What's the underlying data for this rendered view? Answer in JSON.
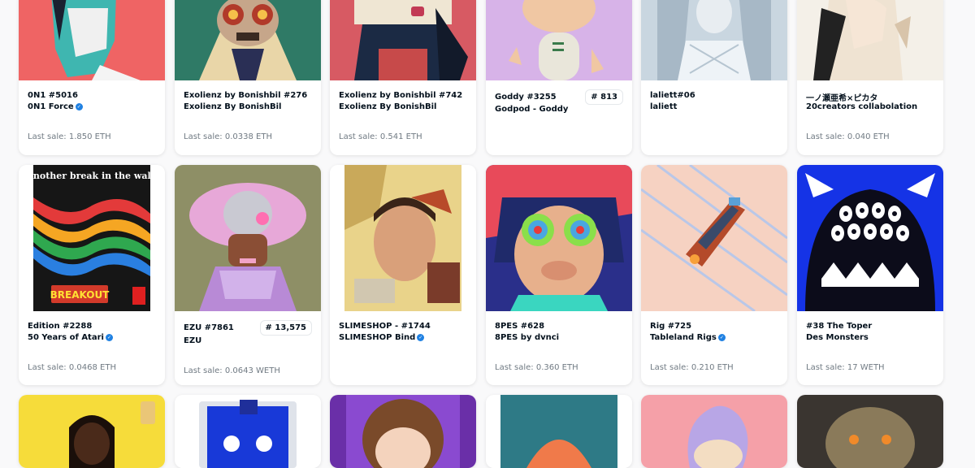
{
  "colors": {
    "verified": "#2081e2",
    "muted": "#707a83",
    "text": "#04111d"
  },
  "sale_prefix": "Last sale:",
  "row1": [
    {
      "title": "0N1 #5016",
      "collection": "0N1 Force",
      "verified": true,
      "sale": "1.850 ETH"
    },
    {
      "title": "Exolienz by Bonishbil #276",
      "collection": "Exolienz By BonishBil",
      "verified": false,
      "sale": "0.0338 ETH"
    },
    {
      "title": "Exolienz by Bonishbil #742",
      "collection": "Exolienz By BonishBil",
      "verified": false,
      "sale": "0.541 ETH"
    },
    {
      "title": "Goddy #3255",
      "collection": "Godpod - Goddy",
      "verified": false,
      "rank": "# 813"
    },
    {
      "title": "laliett#06",
      "collection": "laliett",
      "verified": false
    },
    {
      "title": "一ノ瀬亜希×ピカタ",
      "collection": "20creators collabolation",
      "verified": false,
      "sale": "0.040 ETH"
    }
  ],
  "row2": [
    {
      "title": "Edition #2288",
      "collection": "50 Years of Atari",
      "verified": true,
      "sale": "0.0468 ETH",
      "image_text": "Another break in the wall.",
      "image_text2": "BREAKOUT"
    },
    {
      "title": "EZU #7861",
      "collection": "EZU",
      "verified": false,
      "sale": "0.0643 WETH",
      "rank": "# 13,575"
    },
    {
      "title": "SLIMESHOP - #1744",
      "collection": "SLIMESHOP Bind",
      "verified": true
    },
    {
      "title": "8PES #628",
      "collection": "8PES by dvnci",
      "verified": false,
      "sale": "0.360 ETH"
    },
    {
      "title": "Rig #725",
      "collection": "Tableland Rigs",
      "verified": true,
      "sale": "0.210 ETH"
    },
    {
      "title": "#38 The Toper",
      "collection": "Des Monsters",
      "verified": false,
      "sale": "17 WETH"
    }
  ]
}
